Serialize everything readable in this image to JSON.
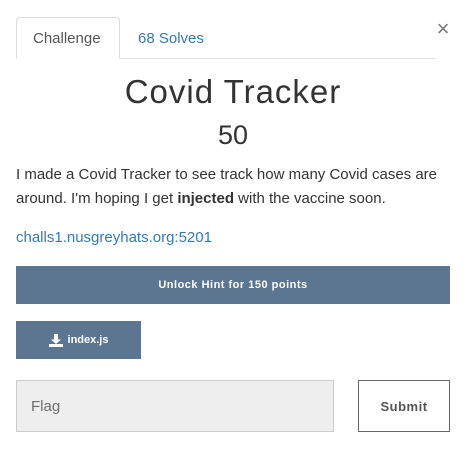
{
  "tabs": [
    {
      "label": "Challenge"
    },
    {
      "label": "68 Solves"
    }
  ],
  "close_glyph": "×",
  "challenge": {
    "title": "Covid Tracker",
    "points": "50",
    "description_before": "I made a Covid Tracker to see track how many Covid cases are around. I'm hoping I get ",
    "description_bold": "injected",
    "description_after": " with the vaccine soon.",
    "link": "challs1.nusgreyhats.org:5201"
  },
  "hint_button": {
    "label": "Unlock Hint for 150 points"
  },
  "file_button": {
    "label": "index.js",
    "icon": "download-icon"
  },
  "flag_input": {
    "placeholder": "Flag",
    "value": ""
  },
  "submit_button": {
    "label": "Submit"
  },
  "colors": {
    "accent": "#5c7591",
    "link": "#337ab7",
    "input_bg": "#eeeeee"
  }
}
